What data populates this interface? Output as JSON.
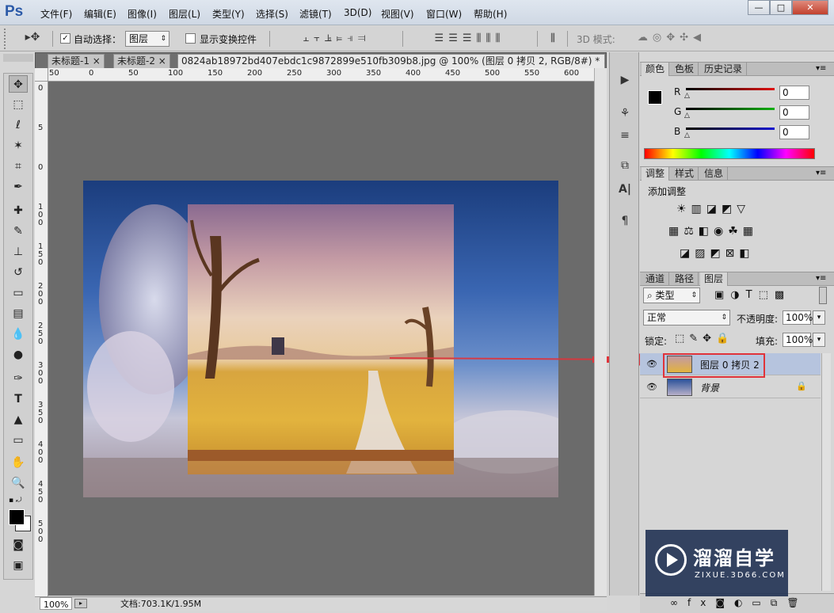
{
  "app": {
    "logo": "Ps"
  },
  "menu": [
    "文件(F)",
    "编辑(E)",
    "图像(I)",
    "图层(L)",
    "类型(Y)",
    "选择(S)",
    "滤镜(T)",
    "3D(D)",
    "视图(V)",
    "窗口(W)",
    "帮助(H)"
  ],
  "window_controls": {
    "minimize": "—",
    "maximize": "□",
    "close": "✕"
  },
  "options": {
    "auto_select_label": "自动选择：",
    "auto_select_value": "图层",
    "show_transform_label": "显示变换控件",
    "mode3d_label": "3D 模式:"
  },
  "tabs": [
    {
      "label": "未标题-1",
      "close": "×"
    },
    {
      "label": "未标题-2",
      "close": "×"
    },
    {
      "label": "0824ab18972bd407ebdc1c9872899e510fb309b8.jpg @ 100% (图层 0 拷贝 2, RGB/8#) *",
      "close": "×"
    }
  ],
  "ruler_h": [
    "50",
    "0",
    "50",
    "100",
    "150",
    "200",
    "250",
    "300",
    "350",
    "400",
    "450",
    "500",
    "550",
    "600"
  ],
  "ruler_v": [
    "0",
    "5",
    "0",
    "1 0 0",
    "1 5 0",
    "2 0 0",
    "2 5 0",
    "3 0 0",
    "3 5 0",
    "4 0 0",
    "4 5 0",
    "5 0 0"
  ],
  "status": {
    "zoom": "100%",
    "doc": "文档:703.1K/1.95M"
  },
  "color_panel": {
    "tabs": [
      "颜色",
      "色板",
      "历史记录"
    ],
    "channels": [
      {
        "label": "R",
        "value": "0",
        "color": "#e01010"
      },
      {
        "label": "G",
        "value": "0",
        "color": "#10b010"
      },
      {
        "label": "B",
        "value": "0",
        "color": "#1010d0"
      }
    ]
  },
  "adjust_panel": {
    "tabs": [
      "调整",
      "样式",
      "信息"
    ],
    "title": "添加调整"
  },
  "layers_panel": {
    "tabs": [
      "通道",
      "路径",
      "图层"
    ],
    "filter_label": "类型",
    "blend_mode": "正常",
    "opacity_label": "不透明度:",
    "opacity_value": "100%",
    "lock_label": "锁定:",
    "fill_label": "填充:",
    "fill_value": "100%",
    "layers": [
      {
        "name": "图层 0 拷贝 2",
        "selected": true
      },
      {
        "name": "背景",
        "selected": false
      }
    ]
  },
  "watermark": {
    "title": "溜溜自学",
    "url": "ZIXUE.3D66.COM"
  },
  "colors": {
    "highlight": "#e0333a",
    "selection": "#b6c4de"
  }
}
